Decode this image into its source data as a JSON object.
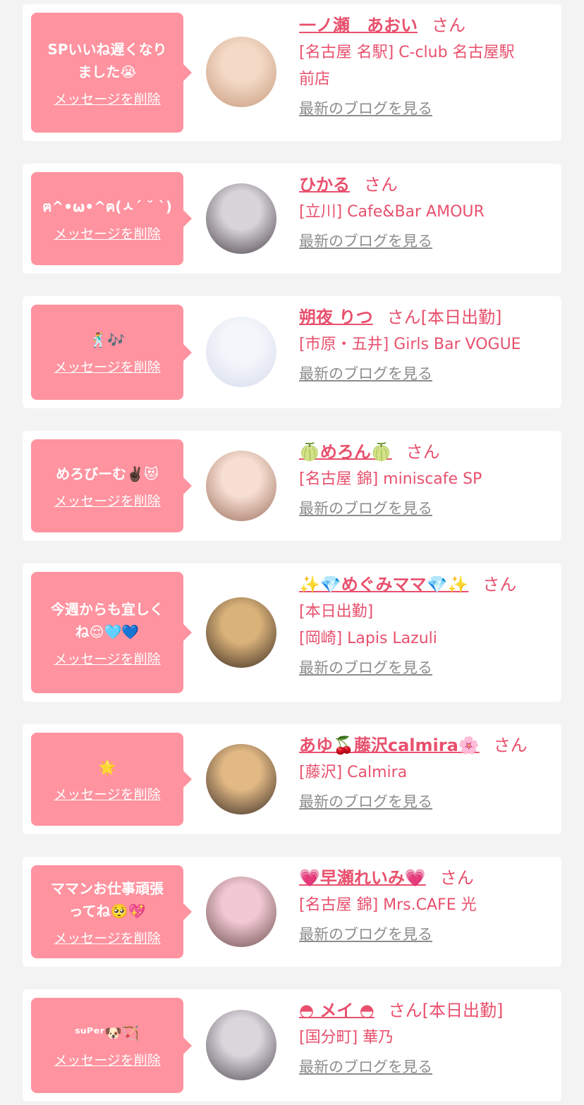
{
  "delete_label": "メッセージを削除",
  "blog_label": "最新のブログを見る",
  "honorific": "さん",
  "entries": [
    {
      "message": "SPいいね遅くなり\nました😭",
      "name": "一ノ瀬　あおい",
      "status": "",
      "lines": [
        "[名古屋 名駅] C-club 名古屋駅",
        "前店"
      ],
      "avatar_colors": [
        "#f3d9c6",
        "#c79b7c"
      ]
    },
    {
      "message": "ฅ^•ω•^ฅ(ㅅ´ ˘ `)",
      "name": "ひかる",
      "status": "",
      "lines": [
        "[立川] Cafe&Bar AMOUR"
      ],
      "avatar_colors": [
        "#d8d4da",
        "#4a4348"
      ]
    },
    {
      "message": "🕺🎶",
      "name": "朔夜 りつ",
      "status": "[本日出勤]",
      "lines": [
        "[市原・五井] Girls Bar VOGUE"
      ],
      "avatar_colors": [
        "#f4f6fb",
        "#d7dcec"
      ]
    },
    {
      "message": "めろびーむ✌🏿😻",
      "name": "🍈めろん🍈",
      "status": "",
      "lines": [
        "[名古屋 錦] miniscafe SP"
      ],
      "avatar_colors": [
        "#f7dfd3",
        "#9c6f5c"
      ]
    },
    {
      "message": "今週からも宜しく\nね😌🩵💙",
      "name": "✨💎めぐみママ💎✨",
      "status": "",
      "lines": [
        "[本日出勤]",
        "[岡崎] Lapis Lazuli"
      ],
      "avatar_colors": [
        "#d9b27a",
        "#3c2b20"
      ]
    },
    {
      "message": "🌟",
      "name": "あゆ🍒藤沢calmira🌸",
      "status": "",
      "lines": [
        "[藤沢] Calmira"
      ],
      "avatar_colors": [
        "#e2b985",
        "#3a2c24"
      ]
    },
    {
      "message": "ママンお仕事頑張\nってね🥺💖",
      "name": "💗早瀬れいみ💗",
      "status": "",
      "lines": [
        "[名古屋 錦] Mrs.CAFE 光"
      ],
      "avatar_colors": [
        "#f1c8d3",
        "#6b4e4c"
      ]
    },
    {
      "message": "ˢᵘᴾᵉʳ🐶🏹",
      "name": "◓ メイ ◓",
      "status": "[本日出勤]",
      "lines": [
        "[国分町] 華乃"
      ],
      "avatar_colors": [
        "#dad6dc",
        "#564f57"
      ]
    }
  ]
}
